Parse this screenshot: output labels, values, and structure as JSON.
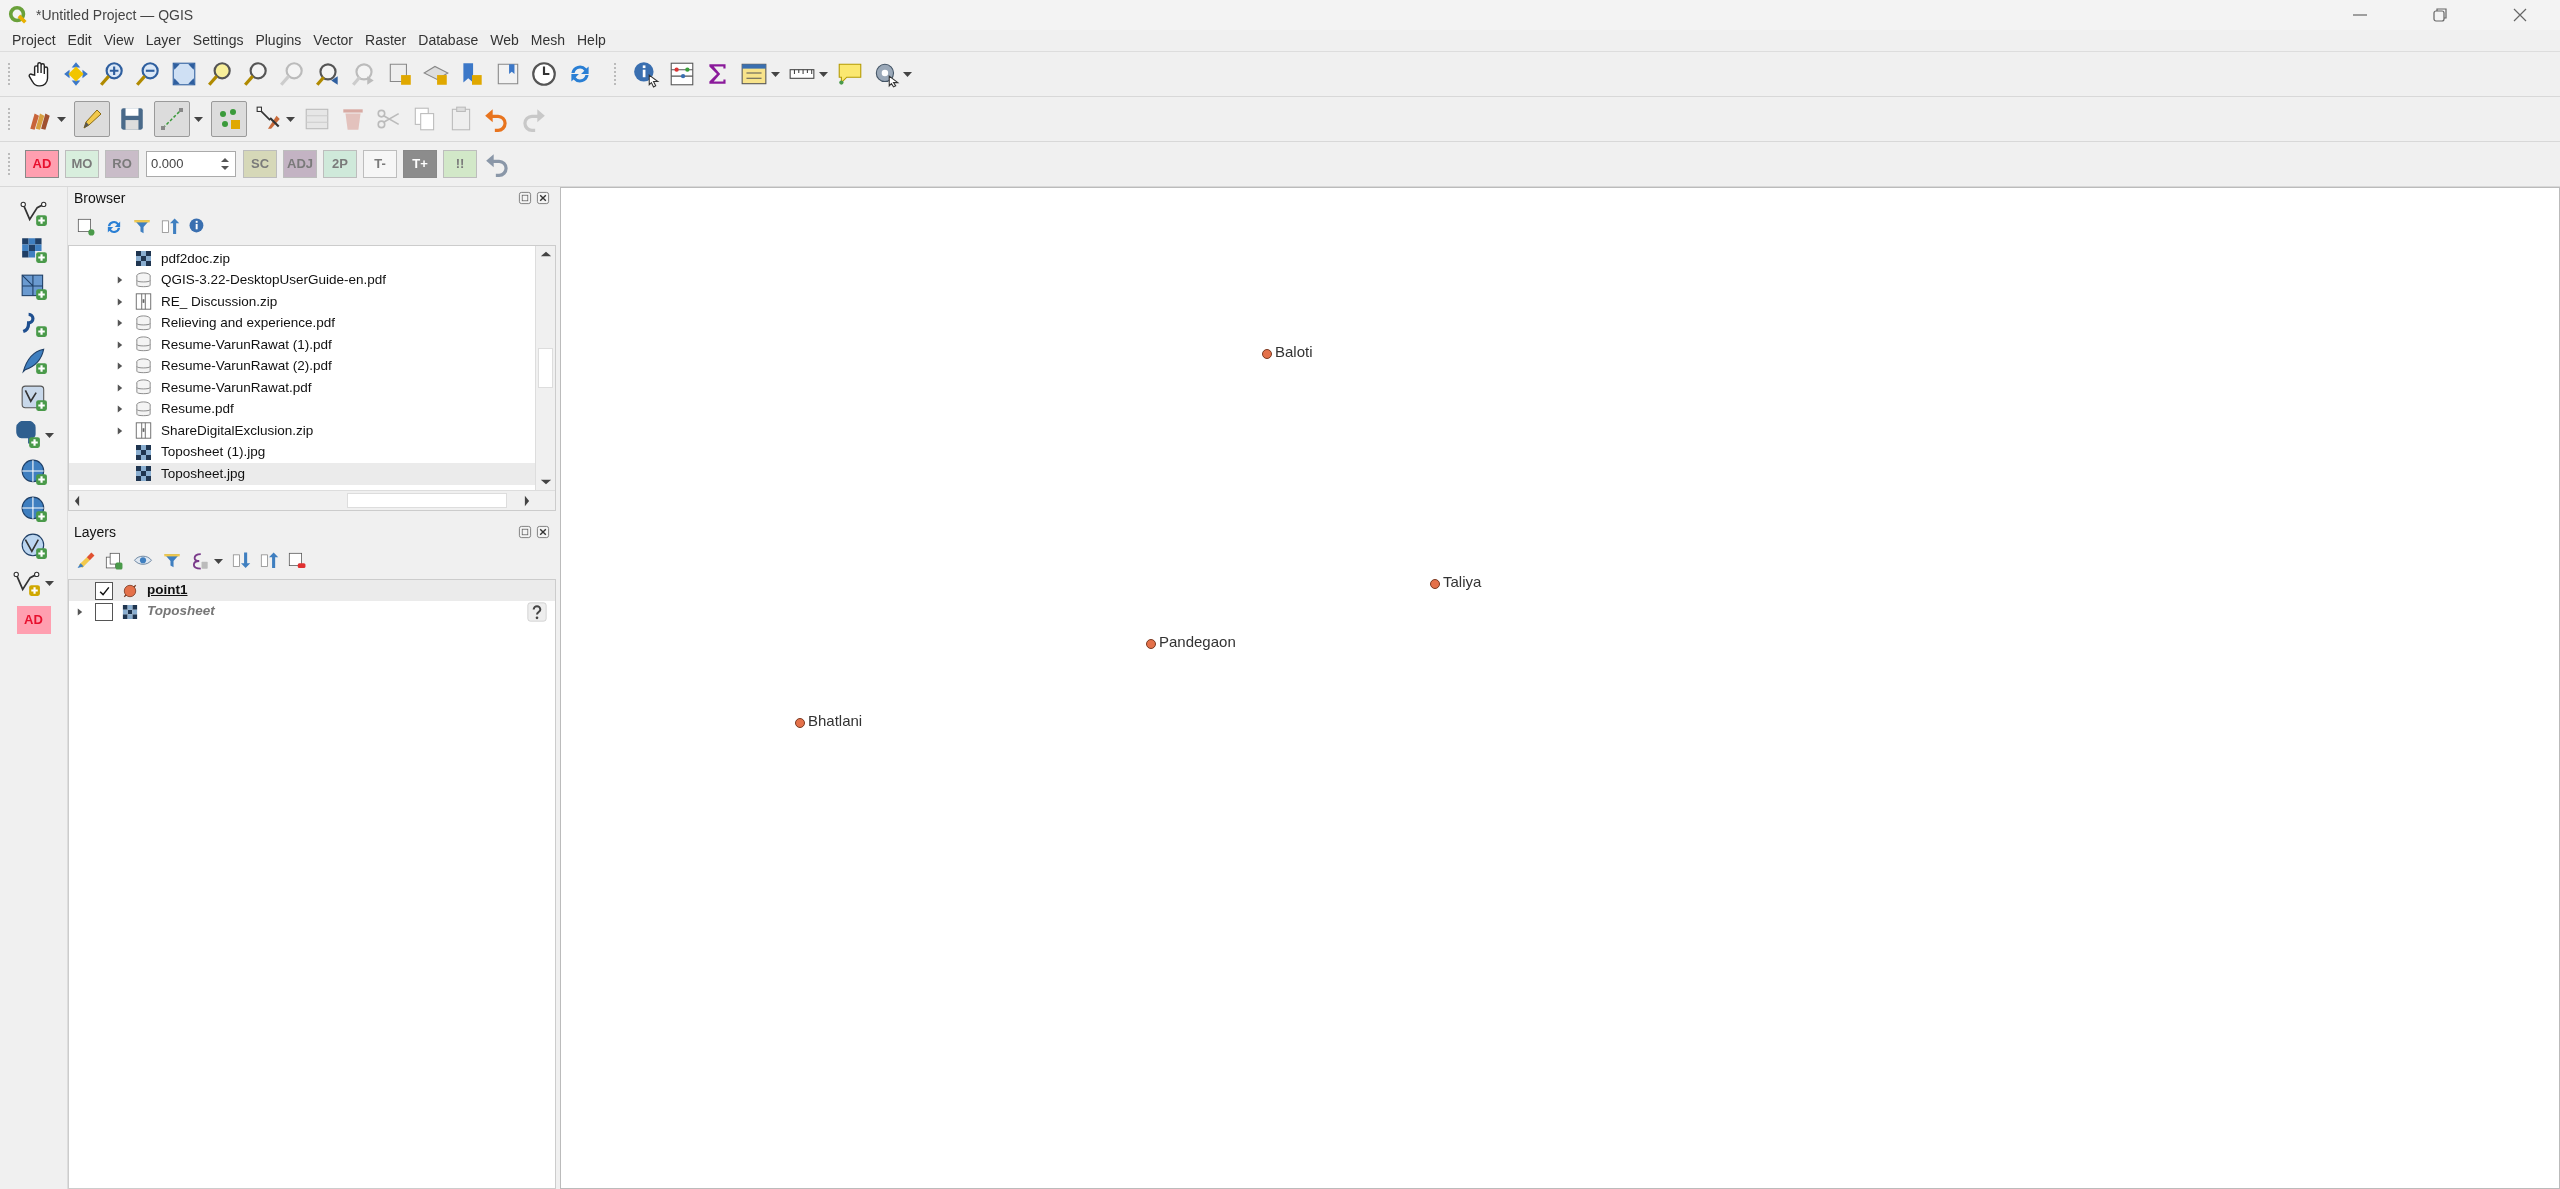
{
  "window": {
    "title": "*Untitled Project — QGIS"
  },
  "menu": [
    "Project",
    "Edit",
    "View",
    "Layer",
    "Settings",
    "Plugins",
    "Vector",
    "Raster",
    "Database",
    "Web",
    "Mesh",
    "Help"
  ],
  "editing": {
    "on": true
  },
  "label_toolbar": {
    "items": [
      {
        "label": "AD",
        "color": "#ff9fb0",
        "disabled": false
      },
      {
        "label": "MO",
        "color": "#d8eedd",
        "disabled": true
      },
      {
        "label": "RO",
        "color": "#c9bcc8",
        "disabled": true
      },
      {
        "kind": "spin",
        "value": "0.000"
      },
      {
        "label": "SC",
        "color": "#d6d8b8",
        "disabled": true
      },
      {
        "label": "ADJ",
        "color": "#c3b3c3",
        "disabled": true
      },
      {
        "label": "2P",
        "color": "#cfe9da",
        "disabled": true
      },
      {
        "label": "T-",
        "color": "#f6f6f6",
        "disabled": true
      },
      {
        "label": "T+",
        "color": "#8c8c8c",
        "disabled": false
      },
      {
        "label": "!!",
        "color": "#d2e8c8",
        "disabled": true
      }
    ]
  },
  "left_toolbar": {
    "label": "AD",
    "color": "#ff9fb0"
  },
  "browser": {
    "title": "Browser",
    "items": [
      {
        "name": "pdf2doc.zip",
        "kind": "raster",
        "has_children": false,
        "selected": false
      },
      {
        "name": "QGIS-3.22-DesktopUserGuide-en.pdf",
        "kind": "database",
        "has_children": true,
        "selected": false
      },
      {
        "name": "RE_ Discussion.zip",
        "kind": "archive",
        "has_children": true,
        "selected": false
      },
      {
        "name": "Relieving and experience.pdf",
        "kind": "database",
        "has_children": true,
        "selected": false
      },
      {
        "name": "Resume-VarunRawat (1).pdf",
        "kind": "database",
        "has_children": true,
        "selected": false
      },
      {
        "name": "Resume-VarunRawat (2).pdf",
        "kind": "database",
        "has_children": true,
        "selected": false
      },
      {
        "name": "Resume-VarunRawat.pdf",
        "kind": "database",
        "has_children": true,
        "selected": false
      },
      {
        "name": "Resume.pdf",
        "kind": "database",
        "has_children": true,
        "selected": false
      },
      {
        "name": "ShareDigitalExclusion.zip",
        "kind": "archive",
        "has_children": true,
        "selected": false
      },
      {
        "name": "Toposheet (1).jpg",
        "kind": "raster",
        "has_children": false,
        "selected": false
      },
      {
        "name": "Toposheet.jpg",
        "kind": "raster",
        "has_children": false,
        "selected": true
      }
    ]
  },
  "layers": {
    "title": "Layers",
    "items": [
      {
        "name": "point1",
        "kind": "vector",
        "checked": true,
        "active": true,
        "selected": true,
        "has_children": false,
        "warning": false
      },
      {
        "name": "Toposheet",
        "kind": "raster",
        "checked": false,
        "active": false,
        "selected": false,
        "has_children": true,
        "warning": true
      }
    ]
  },
  "map": {
    "points": [
      {
        "label": "Baloti"
      },
      {
        "label": "Taliya"
      },
      {
        "label": "Pandegaon"
      },
      {
        "label": "Bhatlani"
      }
    ]
  }
}
